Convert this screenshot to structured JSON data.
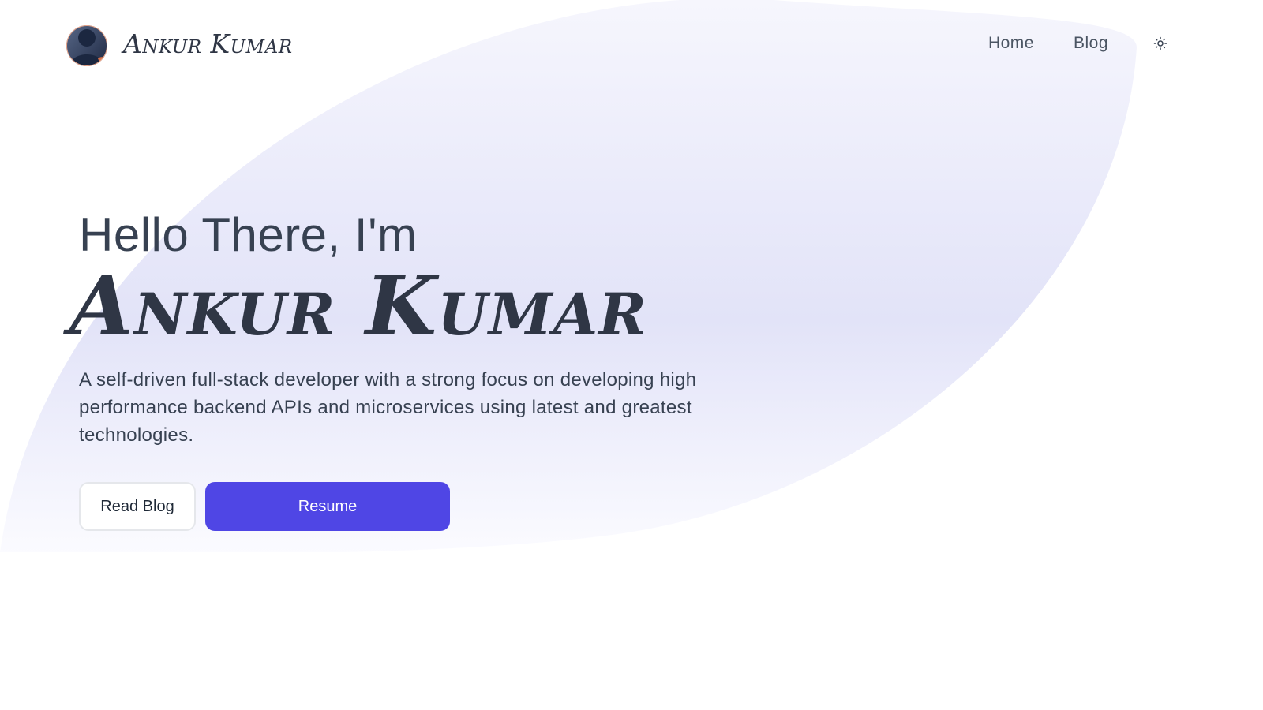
{
  "header": {
    "logo_text": "Ankur Kumar",
    "avatar_alt": "avatar",
    "nav": [
      {
        "label": "Home"
      },
      {
        "label": "Blog"
      }
    ],
    "theme_icon": "sun-icon"
  },
  "hero": {
    "greeting": "Hello There, I'm",
    "name": "Ankur Kumar",
    "tagline": "A self-driven full-stack developer with a strong focus on developing high performance backend APIs and microservices using latest and greatest technologies.",
    "buttons": {
      "read_blog": "Read Blog",
      "resume": "Resume"
    }
  },
  "colors": {
    "accent": "#4f46e5",
    "text": "#374151",
    "blob": "#e0e3fa"
  }
}
